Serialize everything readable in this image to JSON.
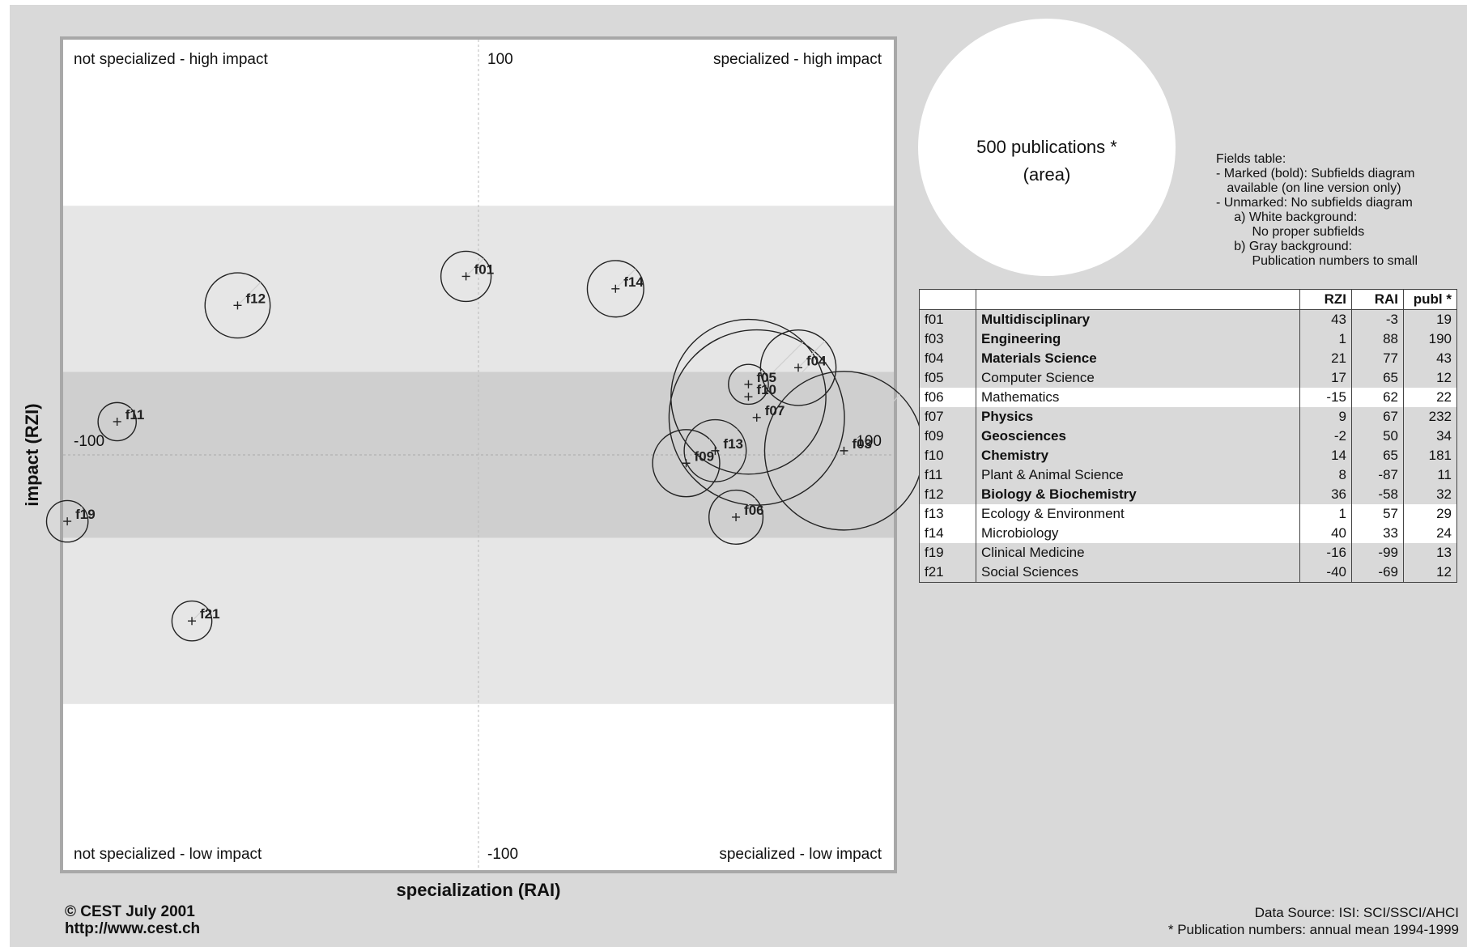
{
  "quadrant_labels": {
    "top_left": "not specialized - high impact",
    "top_right": "specialized - high impact",
    "bottom_left": "not specialized - low impact",
    "bottom_right": "specialized - low impact"
  },
  "reference_circle": {
    "line1": "500 publications *",
    "line2": "(area)"
  },
  "fields_note": {
    "lines": [
      "Fields table:",
      "- Marked (bold): Subfields diagram",
      "   available (on line version only)",
      "- Unmarked: No subfields diagram",
      "     a) White background:",
      "          No proper subfields",
      "     b) Gray background:",
      "          Publication numbers to small"
    ]
  },
  "table": {
    "headers": [
      "",
      "",
      "RZI",
      "RAI",
      "publ *"
    ],
    "rows": [
      {
        "code": "f01",
        "name": "Multidisciplinary",
        "rzi": "43",
        "rai": "-3",
        "publ": "19",
        "bold": true,
        "bg": "gray"
      },
      {
        "code": "f03",
        "name": "Engineering",
        "rzi": "1",
        "rai": "88",
        "publ": "190",
        "bold": true,
        "bg": "gray"
      },
      {
        "code": "f04",
        "name": "Materials Science",
        "rzi": "21",
        "rai": "77",
        "publ": "43",
        "bold": true,
        "bg": "gray"
      },
      {
        "code": "f05",
        "name": "Computer Science",
        "rzi": "17",
        "rai": "65",
        "publ": "12",
        "bold": false,
        "bg": "gray"
      },
      {
        "code": "f06",
        "name": "Mathematics",
        "rzi": "-15",
        "rai": "62",
        "publ": "22",
        "bold": false,
        "bg": "white"
      },
      {
        "code": "f07",
        "name": "Physics",
        "rzi": "9",
        "rai": "67",
        "publ": "232",
        "bold": true,
        "bg": "gray"
      },
      {
        "code": "f09",
        "name": "Geosciences",
        "rzi": "-2",
        "rai": "50",
        "publ": "34",
        "bold": true,
        "bg": "gray"
      },
      {
        "code": "f10",
        "name": "Chemistry",
        "rzi": "14",
        "rai": "65",
        "publ": "181",
        "bold": true,
        "bg": "gray"
      },
      {
        "code": "f11",
        "name": "Plant & Animal Science",
        "rzi": "8",
        "rai": "-87",
        "publ": "11",
        "bold": false,
        "bg": "gray"
      },
      {
        "code": "f12",
        "name": "Biology & Biochemistry",
        "rzi": "36",
        "rai": "-58",
        "publ": "32",
        "bold": true,
        "bg": "gray"
      },
      {
        "code": "f13",
        "name": "Ecology & Environment",
        "rzi": "1",
        "rai": "57",
        "publ": "29",
        "bold": false,
        "bg": "white"
      },
      {
        "code": "f14",
        "name": "Microbiology",
        "rzi": "40",
        "rai": "33",
        "publ": "24",
        "bold": false,
        "bg": "white"
      },
      {
        "code": "f19",
        "name": "Clinical Medicine",
        "rzi": "-16",
        "rai": "-99",
        "publ": "13",
        "bold": false,
        "bg": "gray"
      },
      {
        "code": "f21",
        "name": "Social Sciences",
        "rzi": "-40",
        "rai": "-69",
        "publ": "12",
        "bold": false,
        "bg": "gray"
      }
    ]
  },
  "footer": {
    "copyright": "© CEST July 2001",
    "url": "http://www.cest.ch",
    "source": "Data Source:  ISI: SCI/SSCI/AHCI",
    "note": "* Publication numbers: annual mean 1994-1999"
  },
  "chart_data": {
    "type": "scatter",
    "subtype": "bubble",
    "xlabel": "specialization (RAI)",
    "ylabel": "impact (RZI)",
    "xlim": [
      -100,
      100
    ],
    "ylim": [
      -100,
      100
    ],
    "tick_labels": {
      "x_max": "100",
      "y_max": "100",
      "y_min": "-100",
      "x_min": "-100"
    },
    "bubble_size": "area proportional to publications",
    "reference_bubble_publications": 500,
    "points": [
      {
        "label": "f01",
        "x": -3,
        "y": 43,
        "publ": 19
      },
      {
        "label": "f03",
        "x": 88,
        "y": 1,
        "publ": 190
      },
      {
        "label": "f04",
        "x": 77,
        "y": 21,
        "publ": 43
      },
      {
        "label": "f05",
        "x": 65,
        "y": 17,
        "publ": 12
      },
      {
        "label": "f06",
        "x": 62,
        "y": -15,
        "publ": 22
      },
      {
        "label": "f07",
        "x": 67,
        "y": 9,
        "publ": 232
      },
      {
        "label": "f09",
        "x": 50,
        "y": -2,
        "publ": 34
      },
      {
        "label": "f10",
        "x": 65,
        "y": 14,
        "publ": 181
      },
      {
        "label": "f11",
        "x": -87,
        "y": 8,
        "publ": 11
      },
      {
        "label": "f12",
        "x": -58,
        "y": 36,
        "publ": 32
      },
      {
        "label": "f13",
        "x": 57,
        "y": 1,
        "publ": 29
      },
      {
        "label": "f14",
        "x": 33,
        "y": 40,
        "publ": 24
      },
      {
        "label": "f19",
        "x": -99,
        "y": -16,
        "publ": 13
      },
      {
        "label": "f21",
        "x": -69,
        "y": -40,
        "publ": 12
      }
    ],
    "background_bands": "white |y|>60, light gray 20<|y|<=60, mid gray |y|<=20",
    "grid": false
  }
}
